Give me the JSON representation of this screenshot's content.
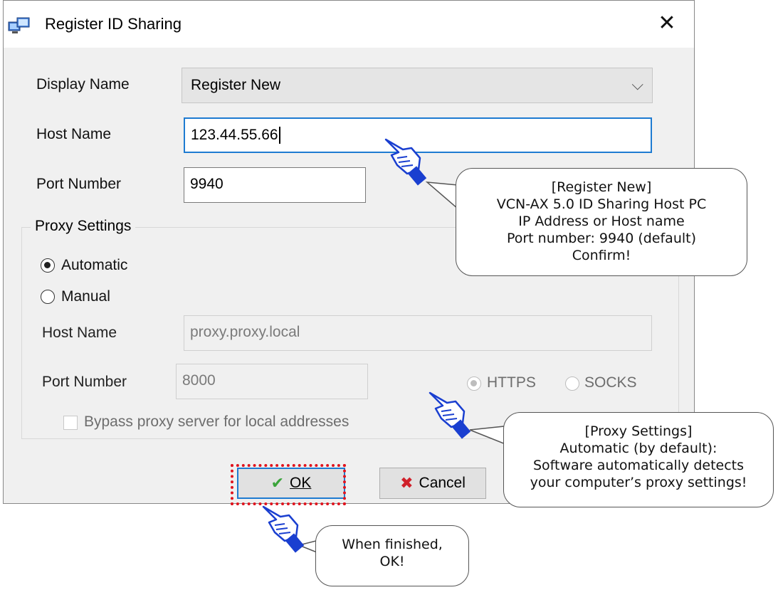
{
  "window": {
    "title": "Register ID Sharing",
    "close_symbol": "✕"
  },
  "form": {
    "display_name_label": "Display Name",
    "display_name_value": "Register New",
    "host_name_label": "Host Name",
    "host_name_value": "123.44.55.66",
    "port_number_label": "Port Number",
    "port_number_value": "9940"
  },
  "proxy": {
    "group_label": "Proxy Settings",
    "automatic_label": "Automatic",
    "manual_label": "Manual",
    "selected": "Automatic",
    "host_name_label": "Host Name",
    "host_name_value": "proxy.proxy.local",
    "port_number_label": "Port Number",
    "port_number_value": "8000",
    "https_label": "HTTPS",
    "socks_label": "SOCKS",
    "bypass_label": "Bypass proxy server for local addresses"
  },
  "buttons": {
    "ok_label": "OK",
    "cancel_label": "Cancel"
  },
  "callouts": {
    "register": [
      "[Register New]",
      "VCN-AX 5.0 ID Sharing Host PC",
      "IP Address or Host name",
      "Port number: 9940 (default)",
      "Confirm!"
    ],
    "proxy": [
      "[Proxy Settings]",
      "Automatic (by default):",
      "Software automatically detects",
      "your computer’s proxy settings!"
    ],
    "finish": [
      "When finished,",
      "OK!"
    ]
  },
  "colors": {
    "accent": "#1e7bd1",
    "highlight": "#e0141e",
    "hand": "#1a3fd0"
  }
}
